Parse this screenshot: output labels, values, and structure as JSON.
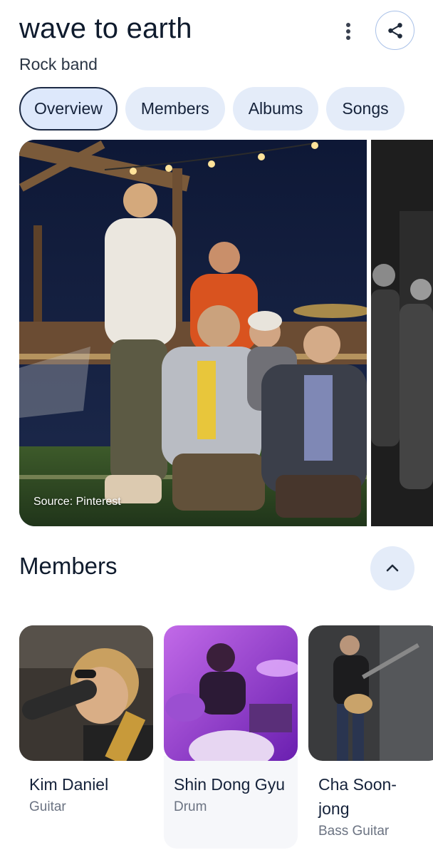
{
  "header": {
    "title": "wave to earth",
    "subtitle": "Rock band",
    "more_icon": "more-vert-icon",
    "share_icon": "share-icon"
  },
  "tabs": [
    {
      "label": "Overview",
      "active": true
    },
    {
      "label": "Members",
      "active": false
    },
    {
      "label": "Albums",
      "active": false
    },
    {
      "label": "Songs",
      "active": false
    }
  ],
  "hero": {
    "source_label": "Source: Pinterest"
  },
  "members_section": {
    "title": "Members",
    "collapse_icon": "chevron-up-icon",
    "members": [
      {
        "name": "Kim Daniel",
        "role": "Guitar"
      },
      {
        "name": "Shin Dong Gyu",
        "role": "Drum"
      },
      {
        "name": "Cha Soon-\njong",
        "role": "Bass Guitar"
      }
    ]
  },
  "colors": {
    "accent": "#1d2b45",
    "chip_bg": "#e4ecf9",
    "share_border": "#a9c1e8"
  }
}
